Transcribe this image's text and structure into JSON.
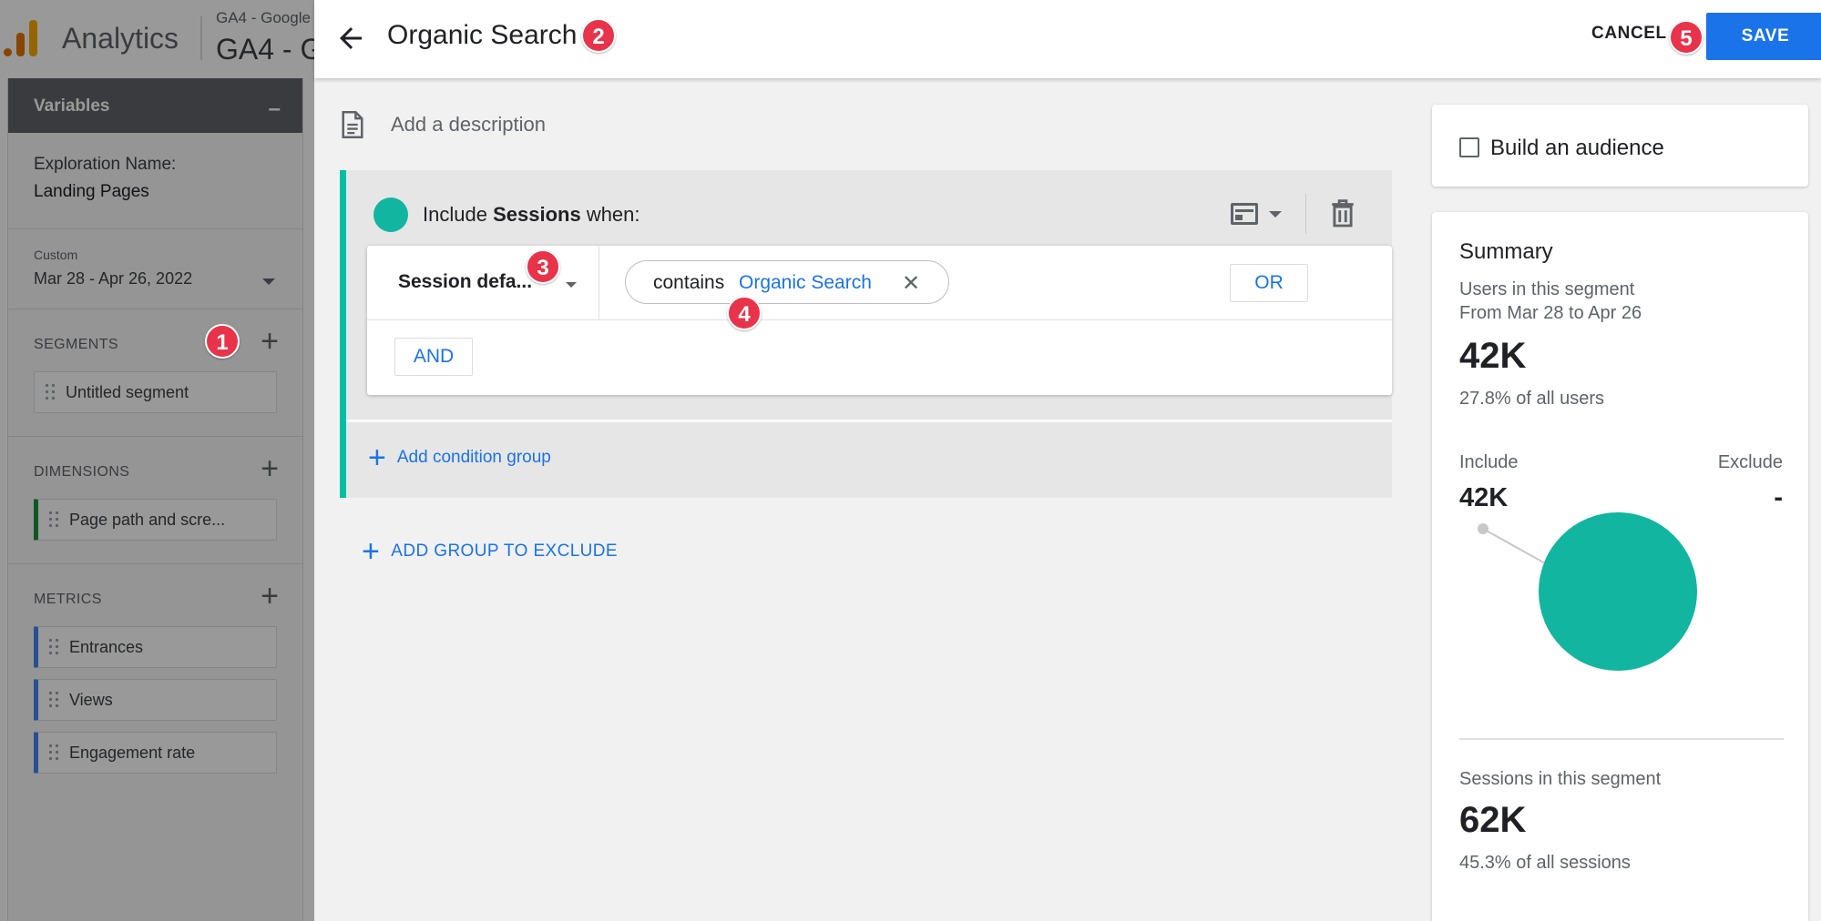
{
  "app": {
    "name": "Analytics",
    "property_small": "GA4 - Google",
    "property_big": "GA4 - G"
  },
  "variables": {
    "header": "Variables",
    "collapse": "–",
    "exploration_label": "Exploration Name:",
    "exploration_name": "Landing Pages",
    "date_tag": "Custom",
    "date_range": "Mar 28 - Apr 26, 2022",
    "segments_title": "SEGMENTS",
    "segments": [
      "Untitled segment"
    ],
    "dimensions_title": "DIMENSIONS",
    "dimensions": [
      "Page path and scre..."
    ],
    "metrics_title": "METRICS",
    "metrics": [
      "Entrances",
      "Views",
      "Engagement rate"
    ]
  },
  "panel": {
    "title": "Organic Search",
    "cancel": "CANCEL",
    "save": "SAVE",
    "description_placeholder": "Add a description",
    "include_prefix": "Include",
    "include_scope": "Sessions",
    "include_suffix": "when:",
    "dimension": "Session defa...",
    "operator": "contains",
    "value": "Organic Search",
    "or": "OR",
    "and": "AND",
    "add_condition_group": "Add condition group",
    "add_group_exclude": "ADD GROUP TO EXCLUDE"
  },
  "badges": [
    "1",
    "2",
    "3",
    "4",
    "5"
  ],
  "audience": {
    "label": "Build an audience",
    "checked": false
  },
  "summary": {
    "title": "Summary",
    "users_label": "Users in this segment",
    "range": "From Mar 28 to Apr 26",
    "users": "42K",
    "users_pct": "27.8% of all users",
    "include_label": "Include",
    "exclude_label": "Exclude",
    "include_value": "42K",
    "exclude_value": "-",
    "sessions_label": "Sessions in this segment",
    "sessions": "62K",
    "sessions_pct": "45.3% of all sessions",
    "include_share": 1.0
  },
  "colors": {
    "accent": "#1a73e8",
    "segment": "#12b5a0",
    "badge": "#e8334a"
  }
}
